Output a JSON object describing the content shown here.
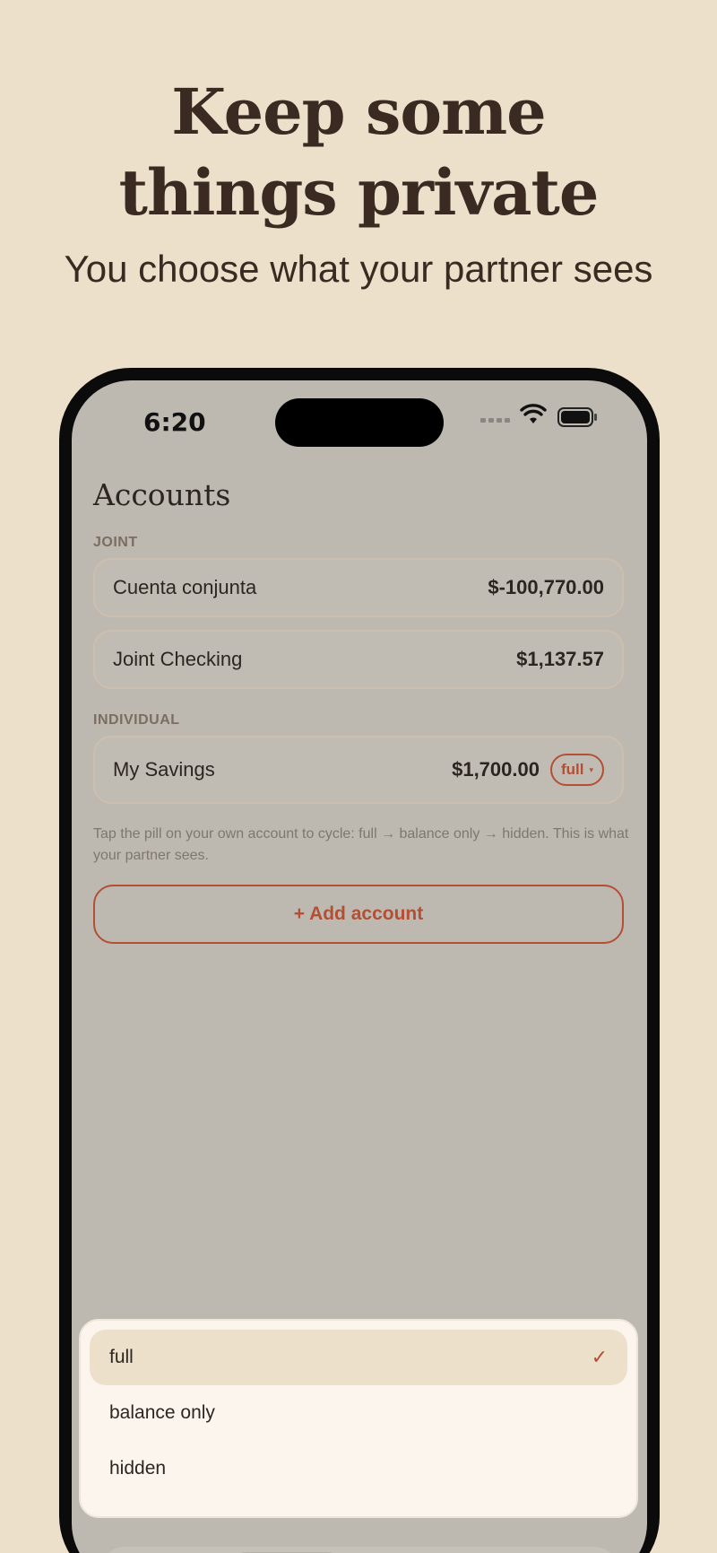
{
  "marketing": {
    "headline_line1": "Keep some",
    "headline_line2": "things private",
    "subhead": "You choose what your partner sees"
  },
  "status_bar": {
    "time": "6:20"
  },
  "screen": {
    "title": "Accounts",
    "sections": {
      "joint_label": "JOINT",
      "individual_label": "INDIVIDUAL"
    },
    "joint_accounts": [
      {
        "name": "Cuenta conjunta",
        "balance": "$-100,770.00"
      },
      {
        "name": "Joint Checking",
        "balance": "$1,137.57"
      }
    ],
    "individual_accounts": [
      {
        "name": "My Savings",
        "balance": "$1,700.00",
        "visibility": "full"
      }
    ],
    "help_text": "Tap the pill on your own account to cycle: full → balance only → hidden. This is what your partner sees.",
    "add_button": "+ Add account"
  },
  "visibility_menu": {
    "options": [
      "full",
      "balance only",
      "hidden"
    ],
    "selected": "full",
    "check_glyph": "✓"
  },
  "colors": {
    "accent": "#b44f34",
    "page_bg": "#ede0cb",
    "screen_bg": "#bdb9b1"
  }
}
